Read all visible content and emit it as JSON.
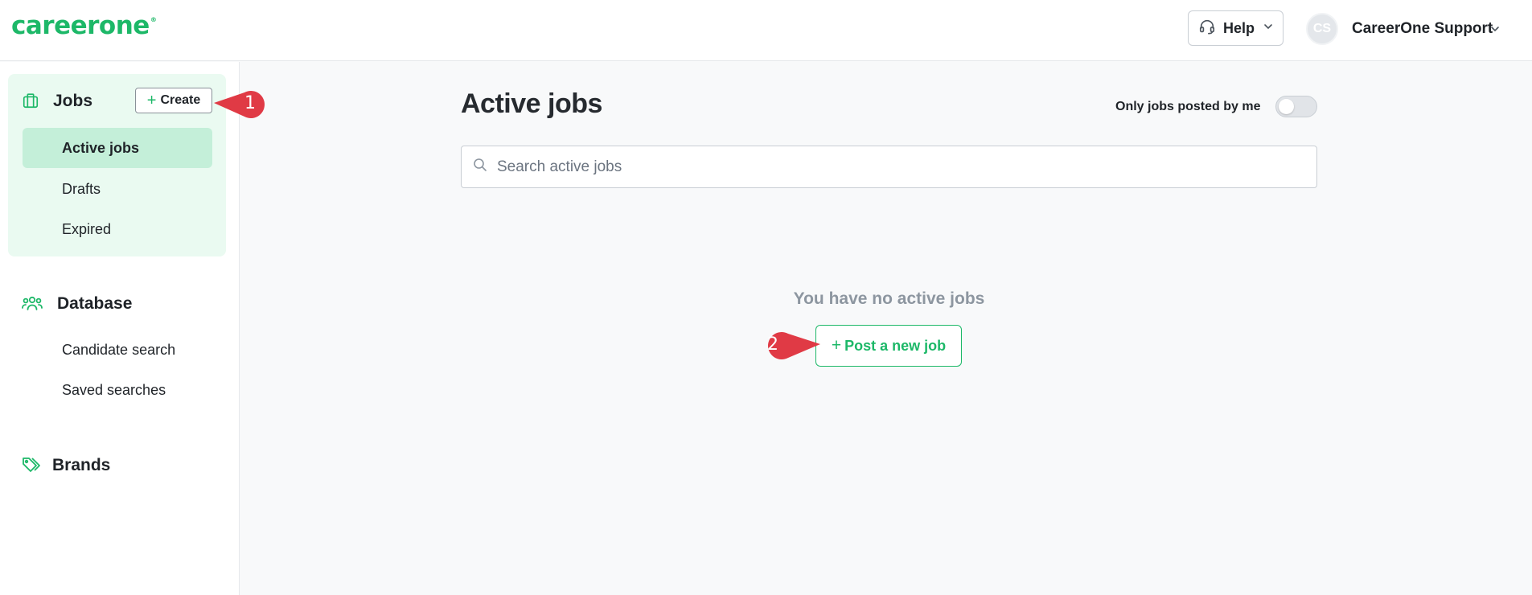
{
  "header": {
    "logo_text": "careerone",
    "logo_mark": "®",
    "help_label": "Help",
    "avatar_initials": "CS",
    "user_name": "CareerOne Support"
  },
  "sidebar": {
    "jobs": {
      "title": "Jobs",
      "icon": "briefcase-icon",
      "create_label": "Create",
      "items": [
        {
          "label": "Active jobs",
          "active": true
        },
        {
          "label": "Drafts",
          "active": false
        },
        {
          "label": "Expired",
          "active": false
        }
      ]
    },
    "database": {
      "title": "Database",
      "icon": "people-icon",
      "items": [
        {
          "label": "Candidate search"
        },
        {
          "label": "Saved searches"
        }
      ]
    },
    "brands": {
      "title": "Brands",
      "icon": "tag-icon"
    }
  },
  "main": {
    "title": "Active jobs",
    "filter_label": "Only jobs posted by me",
    "filter_on": false,
    "search_placeholder": "Search active jobs",
    "search_value": "",
    "empty_message": "You have no active jobs",
    "post_button_label": "Post a new job"
  },
  "annotations": {
    "marker_1": "1",
    "marker_2": "2"
  },
  "colors": {
    "brand": "#1db868",
    "active_nav": "#c4efd9",
    "panel": "#eafaf1",
    "marker": "#e03a45"
  }
}
